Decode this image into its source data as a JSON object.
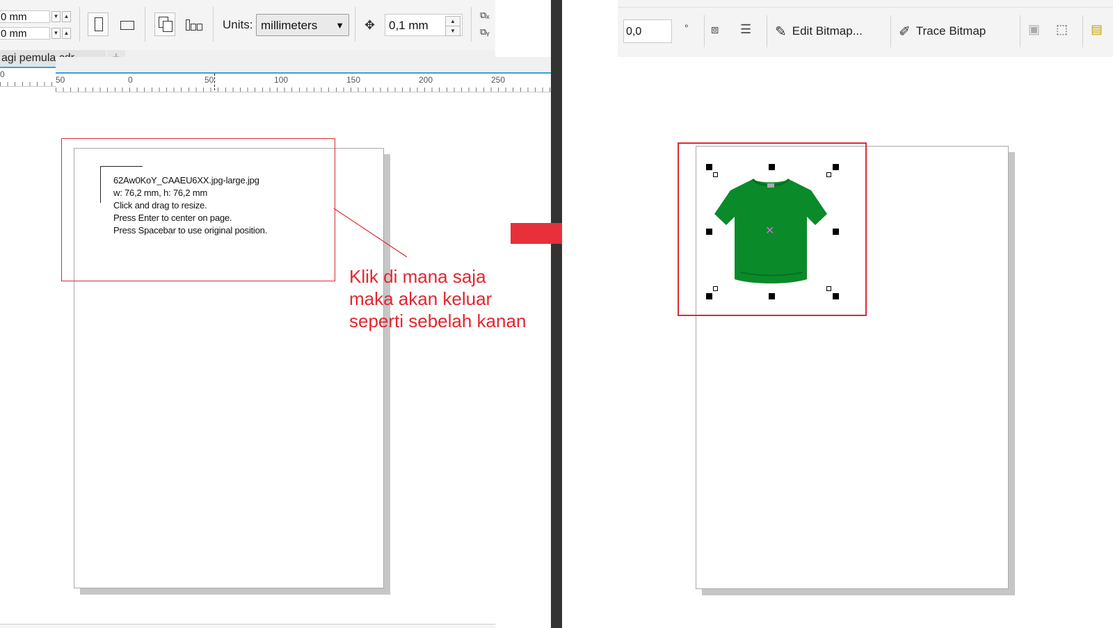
{
  "left": {
    "toolbar": {
      "x_value": "0 mm",
      "y_value": "0 mm",
      "units_label": "Units:",
      "units_value": "millimeters",
      "nudge_value": "0,1 mm"
    },
    "doc_tab": "agi pemula.cdr",
    "tab_add": "+",
    "ruler_labels": [
      "0",
      "0",
      "50",
      "100",
      "150",
      "200",
      "250"
    ],
    "import_tip": [
      "62Aw0KoY_CAAEU6XX.jpg-large.jpg",
      "w: 76,2 mm, h: 76,2 mm",
      "Click and drag to resize.",
      "Press Enter to center on page.",
      "Press Spacebar to use original position."
    ],
    "annotation": [
      "Klik di mana saja",
      "maka akan keluar",
      "seperti sebelah kanan"
    ]
  },
  "right": {
    "toolbar": {
      "angle_value": "0,0",
      "degree_symbol": "°",
      "edit_bitmap": "Edit Bitmap...",
      "trace_bitmap": "Trace Bitmap"
    },
    "ruler_labels": [
      "50",
      "0",
      "50",
      "100",
      "150",
      "200",
      "250"
    ]
  },
  "colors": {
    "annotation_red": "#e3262f",
    "arrow_red": "#e8303a",
    "tshirt_green": "#0b8a2a",
    "divider": "#333333",
    "selection_center": "#d46ad1"
  }
}
